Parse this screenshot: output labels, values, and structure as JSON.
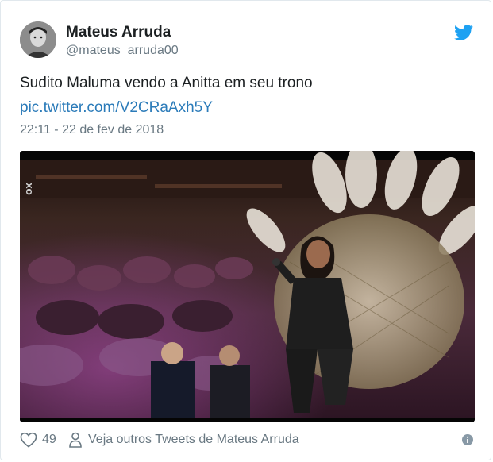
{
  "user": {
    "name": "Mateus Arruda",
    "handle": "@mateus_arruda00"
  },
  "tweet": {
    "text": "Sudito Maluma vendo a Anitta em seu trono",
    "link": "pic.twitter.com/V2CRaAxh5Y",
    "timestamp": "22:11 - 22 de fev de 2018"
  },
  "media": {
    "watermark": "XO"
  },
  "footer": {
    "like_count": "49",
    "more_tweets_label": "Veja outros Tweets de Mateus Arruda"
  },
  "icons": {
    "brand": "twitter-bird-icon",
    "like": "heart-icon",
    "profile": "person-icon",
    "info": "info-icon"
  },
  "colors": {
    "link": "#2b7bb9",
    "brand": "#1da1f2",
    "secondary_text": "#697882",
    "primary_text": "#1c2022",
    "border": "#e1e8ed"
  }
}
